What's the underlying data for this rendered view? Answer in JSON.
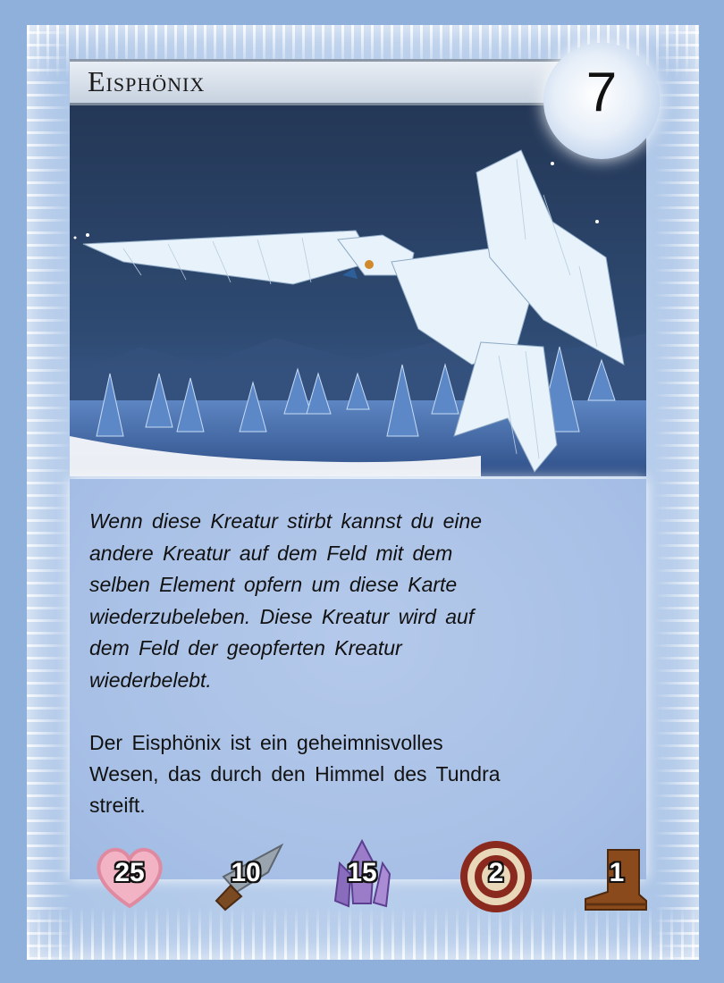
{
  "card": {
    "title": "Eisphönix",
    "cost": "7",
    "ability_lines": [
      "Wenn diese Kreatur stirbt kannst du eine",
      "andere Kreatur auf dem Feld mit dem",
      "selben Element opfern um diese Karte",
      "wiederzubeleben. Diese Kreatur wird auf",
      "dem Feld der geopferten Kreatur",
      "wiederbelebt."
    ],
    "flavor_lines": [
      "Der Eisphönix ist ein geheimnisvolles",
      "Wesen, das durch den Himmel des Tundra",
      "streift."
    ],
    "stats": {
      "health": "25",
      "attack": "10",
      "crystal": "15",
      "range": "2",
      "movement": "1"
    },
    "icons": {
      "health": "heart-icon",
      "attack": "sword-icon",
      "crystal": "crystal-icon",
      "range": "target-icon",
      "movement": "boot-icon"
    },
    "colors": {
      "background": "#8fb0da",
      "panel": "#a8c0e6",
      "night_sky": "#2b3f63",
      "heart": "#f2b4c4",
      "crystal": "#9a7cc8",
      "target_red": "#8a2a1e",
      "boot": "#8a4a1c"
    }
  }
}
